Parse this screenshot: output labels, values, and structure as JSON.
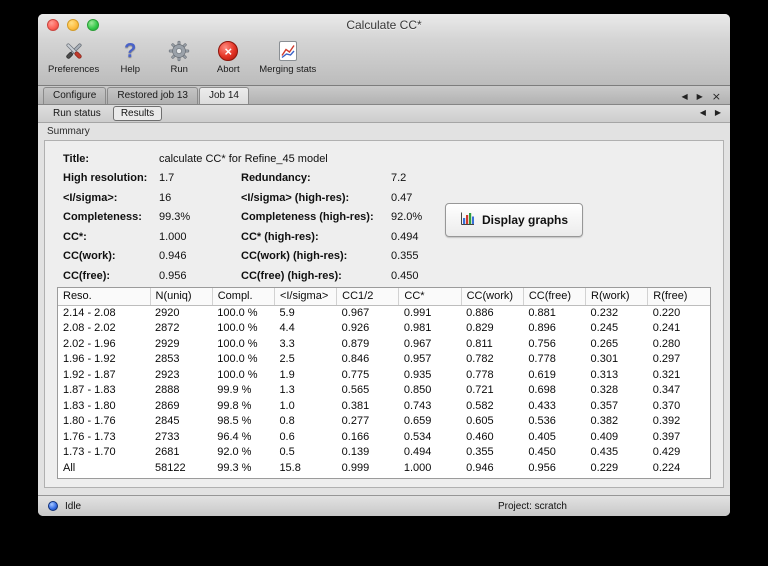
{
  "window": {
    "title": "Calculate CC*",
    "status": "Idle",
    "project": "Project: scratch"
  },
  "glyphs": {
    "back": "◀",
    "forward": "▶",
    "close": "×"
  },
  "toolbar": {
    "items": [
      {
        "label": "Preferences"
      },
      {
        "label": "Help"
      },
      {
        "label": "Run"
      },
      {
        "label": "Abort"
      },
      {
        "label": "Merging stats"
      }
    ]
  },
  "tabs": [
    {
      "label": "Configure"
    },
    {
      "label": "Restored job 13"
    },
    {
      "label": "Job 14"
    }
  ],
  "subtabs": [
    {
      "label": "Run status"
    },
    {
      "label": "Results"
    }
  ],
  "section_label": "Summary",
  "summary": {
    "rows": [
      {
        "label": "Title:",
        "value": "calculate CC* for Refine_45 model",
        "label2": "",
        "value2": ""
      },
      {
        "label": "High resolution:",
        "value": "1.7",
        "label2": "Redundancy:",
        "value2": "7.2"
      },
      {
        "label": "<I/sigma>:",
        "value": "16",
        "label2": "<I/sigma> (high-res):",
        "value2": "0.47"
      },
      {
        "label": "Completeness:",
        "value": "99.3%",
        "label2": "Completeness (high-res):",
        "value2": "92.0%"
      },
      {
        "label": "CC*:",
        "value": "1.000",
        "label2": "CC* (high-res):",
        "value2": "0.494"
      },
      {
        "label": "CC(work):",
        "value": "0.946",
        "label2": "CC(work) (high-res):",
        "value2": "0.355"
      },
      {
        "label": "CC(free):",
        "value": "0.956",
        "label2": "CC(free) (high-res):",
        "value2": "0.450"
      }
    ],
    "display_graphs_label": "Display graphs"
  },
  "table": {
    "columns": [
      "Reso.",
      "N(uniq)",
      "Compl.",
      "<I/sigma>",
      "CC1/2",
      "CC*",
      "CC(work)",
      "CC(free)",
      "R(work)",
      "R(free)"
    ],
    "rows": [
      [
        "2.14 - 2.08",
        "2920",
        "100.0 %",
        "5.9",
        "0.967",
        "0.991",
        "0.886",
        "0.881",
        "0.232",
        "0.220"
      ],
      [
        "2.08 - 2.02",
        "2872",
        "100.0 %",
        "4.4",
        "0.926",
        "0.981",
        "0.829",
        "0.896",
        "0.245",
        "0.241"
      ],
      [
        "2.02 - 1.96",
        "2929",
        "100.0 %",
        "3.3",
        "0.879",
        "0.967",
        "0.811",
        "0.756",
        "0.265",
        "0.280"
      ],
      [
        "1.96 - 1.92",
        "2853",
        "100.0 %",
        "2.5",
        "0.846",
        "0.957",
        "0.782",
        "0.778",
        "0.301",
        "0.297"
      ],
      [
        "1.92 - 1.87",
        "2923",
        "100.0 %",
        "1.9",
        "0.775",
        "0.935",
        "0.778",
        "0.619",
        "0.313",
        "0.321"
      ],
      [
        "1.87 - 1.83",
        "2888",
        "99.9 %",
        "1.3",
        "0.565",
        "0.850",
        "0.721",
        "0.698",
        "0.328",
        "0.347"
      ],
      [
        "1.83 - 1.80",
        "2869",
        "99.8 %",
        "1.0",
        "0.381",
        "0.743",
        "0.582",
        "0.433",
        "0.357",
        "0.370"
      ],
      [
        "1.80 - 1.76",
        "2845",
        "98.5 %",
        "0.8",
        "0.277",
        "0.659",
        "0.605",
        "0.536",
        "0.382",
        "0.392"
      ],
      [
        "1.76 - 1.73",
        "2733",
        "96.4 %",
        "0.6",
        "0.166",
        "0.534",
        "0.460",
        "0.405",
        "0.409",
        "0.397"
      ],
      [
        "1.73 - 1.70",
        "2681",
        "92.0 %",
        "0.5",
        "0.139",
        "0.494",
        "0.355",
        "0.450",
        "0.435",
        "0.429"
      ],
      [
        "All",
        "58122",
        "99.3 %",
        "15.8",
        "0.999",
        "1.000",
        "0.946",
        "0.956",
        "0.229",
        "0.224"
      ]
    ]
  }
}
